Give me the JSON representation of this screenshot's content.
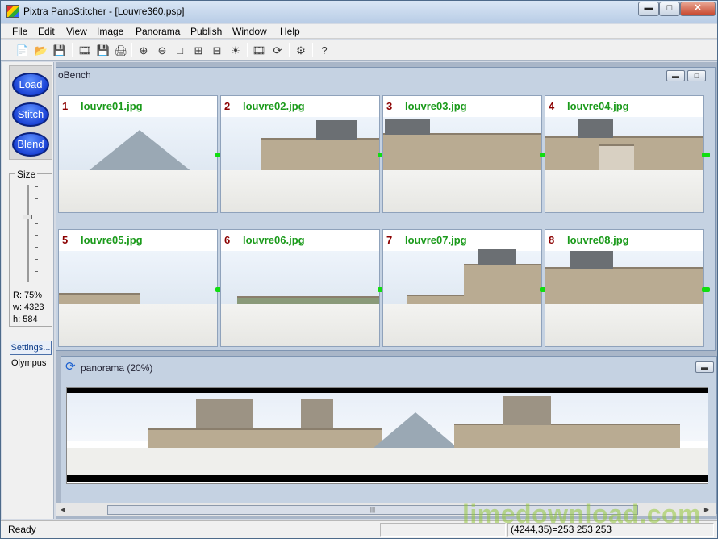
{
  "window": {
    "title": "Pixtra PanoStitcher - [Louvre360.psp]"
  },
  "menu": [
    "File",
    "Edit",
    "View",
    "Image",
    "Panorama",
    "Publish",
    "Window",
    "Help"
  ],
  "toolbar": {
    "icons": [
      "new-icon",
      "open-icon",
      "save-icon",
      "save-project-icon",
      "save-image-icon",
      "print-icon",
      "zoom-in-icon",
      "zoom-out-icon",
      "fit-icon",
      "rotate-icon",
      "align-icon",
      "brightness-icon",
      "film-icon",
      "refresh-icon",
      "settings-icon",
      "help-icon"
    ]
  },
  "left_panel": {
    "actions": [
      "Load",
      "Stitch",
      "Blend"
    ],
    "size_label": "Size",
    "size_level": 0.33,
    "readouts": {
      "ratio": "R: 75%",
      "width": "w: 4323",
      "height": "h: 584"
    },
    "settings_button": "Settings...",
    "camera": "Olympus"
  },
  "photobench": {
    "title": "oBench",
    "photos": [
      {
        "num": "1",
        "name": "louvre01.jpg"
      },
      {
        "num": "2",
        "name": "louvre02.jpg"
      },
      {
        "num": "3",
        "name": "louvre03.jpg"
      },
      {
        "num": "4",
        "name": "louvre04.jpg"
      },
      {
        "num": "5",
        "name": "louvre05.jpg"
      },
      {
        "num": "6",
        "name": "louvre06.jpg"
      },
      {
        "num": "7",
        "name": "louvre07.jpg"
      },
      {
        "num": "8",
        "name": "louvre08.jpg"
      }
    ]
  },
  "panorama": {
    "title": "panorama (20%)"
  },
  "status": {
    "text": "Ready",
    "coords": "(4244,35)=253 253 253"
  },
  "watermark": "limedownload.com"
}
